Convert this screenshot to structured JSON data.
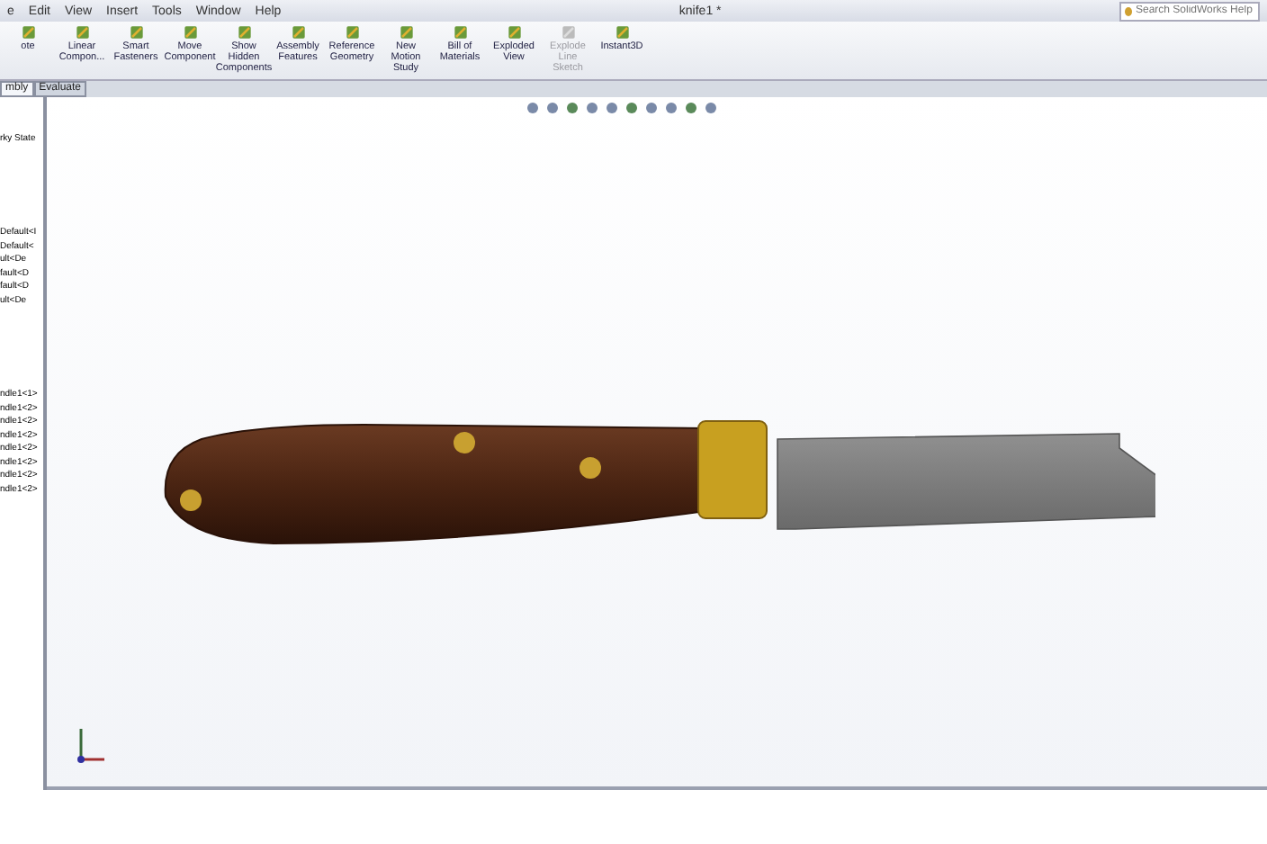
{
  "menu_bar": {
    "items": [
      "e",
      "Edit",
      "View",
      "Insert",
      "Tools",
      "Window",
      "Help"
    ],
    "title": "knife1 *",
    "search": {
      "placeholder": "Search SolidWorks Help"
    }
  },
  "toolbar": {
    "buttons": [
      {
        "label": "ote",
        "disabled": false
      },
      {
        "label": "Linear Compon...",
        "disabled": false
      },
      {
        "label": "Smart Fasteners",
        "disabled": false
      },
      {
        "label": "Move Component",
        "disabled": false
      },
      {
        "label": "Show Hidden Components",
        "disabled": false
      },
      {
        "label": "Assembly Features",
        "disabled": false
      },
      {
        "label": "Reference Geometry",
        "disabled": false
      },
      {
        "label": "New Motion Study",
        "disabled": false
      },
      {
        "label": "Bill of Materials",
        "disabled": false
      },
      {
        "label": "Exploded View",
        "disabled": false
      },
      {
        "label": "Explode Line Sketch",
        "disabled": true
      },
      {
        "label": "Instant3D",
        "disabled": false
      }
    ]
  },
  "tabs": [
    {
      "label": "mbly",
      "selected": true
    },
    {
      "label": "Evaluate",
      "selected": false
    }
  ],
  "tree": {
    "header": "rky State",
    "groups": [
      [
        "Default<I",
        "Default<",
        "ult<De",
        "fault<D",
        "fault<D",
        "ult<De"
      ],
      [
        "ndle1<1>",
        "ndle1<2>",
        "ndle1<2>",
        "ndle1<2>",
        "ndle1<2>",
        "ndle1<2>",
        "ndle1<2>",
        "ndle1<2>"
      ]
    ]
  }
}
